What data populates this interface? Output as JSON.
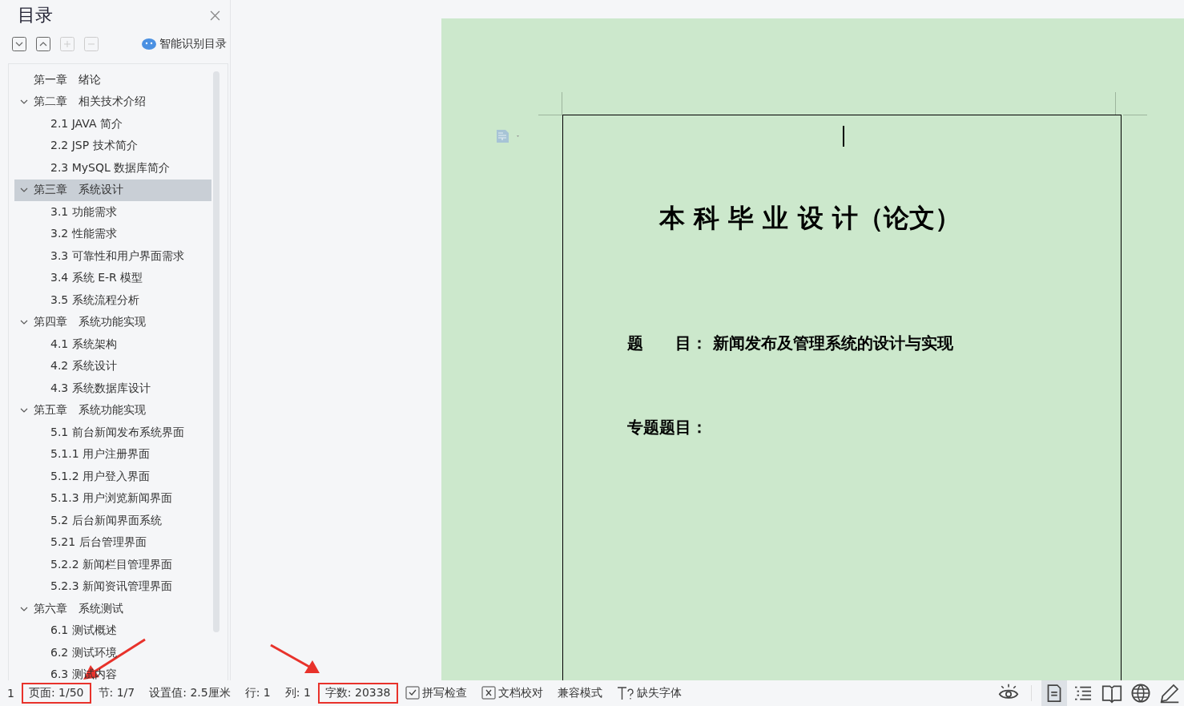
{
  "sidebar": {
    "title": "目录",
    "toolbar": [
      {
        "kind": "down",
        "disabled": false
      },
      {
        "kind": "up",
        "disabled": false
      },
      {
        "kind": "plus",
        "disabled": true
      },
      {
        "kind": "minus",
        "disabled": true
      }
    ],
    "smart_button": "智能识别目录",
    "outline": [
      {
        "label": "第一章　绪论",
        "selected": false
      },
      {
        "label": "第二章　相关技术介绍",
        "selected": false,
        "expanded": true,
        "children": [
          {
            "label": "2.1 JAVA 简介",
            "selected": false
          },
          {
            "label": "2.2 JSP 技术简介",
            "selected": false
          },
          {
            "label": "2.3 MySQL 数据库简介",
            "selected": false
          }
        ]
      },
      {
        "label": "第三章　系统设计",
        "selected": true,
        "expanded": true,
        "children": [
          {
            "label": "3.1 功能需求",
            "selected": false
          },
          {
            "label": "3.2 性能需求",
            "selected": false
          },
          {
            "label": "3.3  可靠性和用户界面需求",
            "selected": false
          },
          {
            "label": "3.4 系统 E-R 模型",
            "selected": false
          },
          {
            "label": "3.5  系统流程分析",
            "selected": false
          }
        ]
      },
      {
        "label": "第四章　系统功能实现",
        "selected": false,
        "expanded": true,
        "children": [
          {
            "label": "4.1  系统架构",
            "selected": false
          },
          {
            "label": "4.2  系统设计",
            "selected": false
          },
          {
            "label": "4.3  系统数据库设计",
            "selected": false
          }
        ]
      },
      {
        "label": "第五章　系统功能实现",
        "selected": false,
        "expanded": true,
        "children": [
          {
            "label": "5.1 前台新闻发布系统界面",
            "selected": false
          },
          {
            "label": "5.1.1 用户注册界面",
            "selected": false
          },
          {
            "label": "5.1.2 用户登入界面",
            "selected": false
          },
          {
            "label": "5.1.3 用户浏览新闻界面",
            "selected": false
          },
          {
            "label": "5.2 后台新闻界面系统",
            "selected": false
          },
          {
            "label": "5.21 后台管理界面",
            "selected": false
          },
          {
            "label": "5.2.2 新闻栏目管理界面",
            "selected": false
          },
          {
            "label": "5.2.3 新闻资讯管理界面",
            "selected": false
          }
        ]
      },
      {
        "label": "第六章　系统测试",
        "selected": false,
        "expanded": true,
        "children": [
          {
            "label": "6.1 测试概述",
            "selected": false
          },
          {
            "label": "6.2 测试环境",
            "selected": false
          },
          {
            "label": "6.3 测试内容",
            "selected": false
          }
        ]
      }
    ]
  },
  "document": {
    "title": "本 科 毕 业 设 计（论文）",
    "fields": [
      {
        "label": "题　　目：",
        "value": "新闻发布及管理系统的设计与实现"
      },
      {
        "label": "专题题目："
      }
    ]
  },
  "status_bar": {
    "items": [
      {
        "kind": "text",
        "text": "1",
        "highlighted": false
      },
      {
        "kind": "text",
        "text": "页面: 1/50",
        "highlighted": true
      },
      {
        "kind": "text",
        "text": "节: 1/7",
        "highlighted": false
      },
      {
        "kind": "text",
        "text": "设置值: 2.5厘米",
        "highlighted": false
      },
      {
        "kind": "text",
        "text": "行: 1",
        "highlighted": false
      },
      {
        "kind": "text",
        "text": "列: 1",
        "highlighted": false
      },
      {
        "kind": "text",
        "text": "字数: 20338",
        "highlighted": true
      },
      {
        "kind": "check",
        "text": "拼写检查",
        "highlighted": false
      },
      {
        "kind": "proof",
        "text": "文档校对",
        "highlighted": false
      },
      {
        "kind": "text",
        "text": "兼容模式",
        "highlighted": false
      },
      {
        "kind": "font",
        "text": "缺失字体",
        "highlighted": false
      }
    ],
    "views": [
      {
        "kind": "eye",
        "selected": false
      },
      {
        "kind": "page",
        "selected": true
      },
      {
        "kind": "outline",
        "selected": false
      },
      {
        "kind": "book",
        "selected": false
      },
      {
        "kind": "web",
        "selected": false
      },
      {
        "kind": "pen",
        "selected": false
      }
    ]
  }
}
